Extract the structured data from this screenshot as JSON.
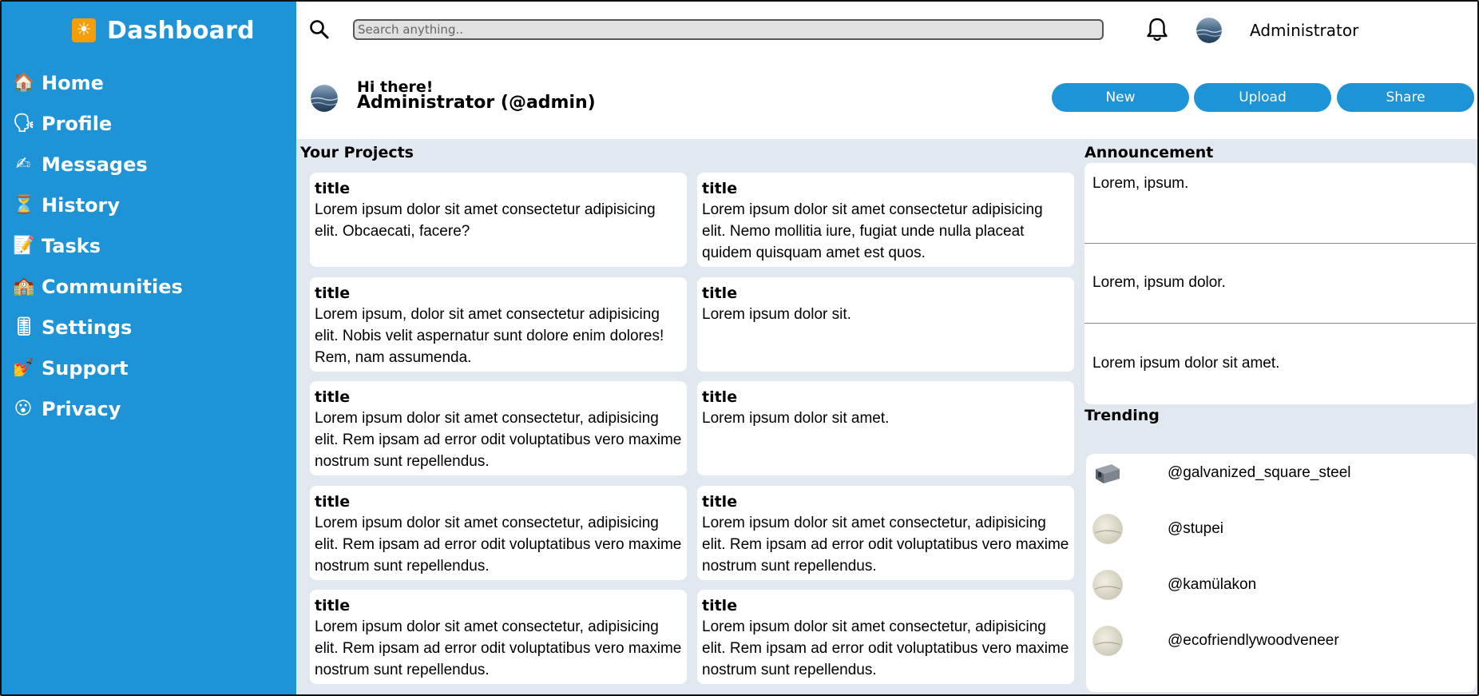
{
  "sidebar": {
    "brand_icon": "☀",
    "brand_title": "Dashboard",
    "items": [
      {
        "icon": "🏠",
        "icon_name": "home-icon",
        "label": "Home"
      },
      {
        "icon": "🗣",
        "icon_name": "speaking-head-icon",
        "label": "Profile"
      },
      {
        "icon": "✍",
        "icon_name": "writing-hand-icon",
        "label": "Messages"
      },
      {
        "icon": "⏳",
        "icon_name": "hourglass-icon",
        "label": "History"
      },
      {
        "icon": "📝",
        "icon_name": "memo-icon",
        "label": "Tasks"
      },
      {
        "icon": "🏫",
        "icon_name": "school-icon",
        "label": "Communities"
      },
      {
        "icon": "🎚",
        "icon_name": "slider-icon",
        "label": "Settings"
      },
      {
        "icon": "💅",
        "icon_name": "nail-polish-icon",
        "label": "Support"
      },
      {
        "icon": "😮",
        "icon_name": "face-icon",
        "label": "Privacy"
      }
    ]
  },
  "header": {
    "search_placeholder": "Search anything..",
    "user_name": "Administrator"
  },
  "greeting": {
    "hi": "Hi there!",
    "name": "Administrator (@admin)",
    "buttons": [
      "New",
      "Upload",
      "Share"
    ]
  },
  "projects": {
    "title": "Your Projects",
    "cards": [
      {
        "title": "title",
        "body": "Lorem ipsum dolor sit amet consectetur adipisicing elit. Obcaecati, facere?"
      },
      {
        "title": "title",
        "body": "Lorem ipsum dolor sit amet consectetur adipisicing elit. Nemo mollitia iure, fugiat unde nulla placeat quidem quisquam amet est quos."
      },
      {
        "title": "title",
        "body": "Lorem ipsum, dolor sit amet consectetur adipisicing elit. Nobis velit aspernatur sunt dolore enim dolores! Rem, nam assumenda."
      },
      {
        "title": "title",
        "body": "Lorem ipsum dolor sit."
      },
      {
        "title": "title",
        "body": "Lorem ipsum dolor sit amet consectetur, adipisicing elit. Rem ipsam ad error odit voluptatibus vero maxime nostrum sunt repellendus."
      },
      {
        "title": "title",
        "body": "Lorem ipsum dolor sit amet."
      },
      {
        "title": "title",
        "body": "Lorem ipsum dolor sit amet consectetur, adipisicing elit. Rem ipsam ad error odit voluptatibus vero maxime nostrum sunt repellendus."
      },
      {
        "title": "title",
        "body": "Lorem ipsum dolor sit amet consectetur, adipisicing elit. Rem ipsam ad error odit voluptatibus vero maxime nostrum sunt repellendus."
      },
      {
        "title": "title",
        "body": "Lorem ipsum dolor sit amet consectetur, adipisicing elit. Rem ipsam ad error odit voluptatibus vero maxime nostrum sunt repellendus."
      },
      {
        "title": "title",
        "body": "Lorem ipsum dolor sit amet consectetur, adipisicing elit. Rem ipsam ad error odit voluptatibus vero maxime nostrum sunt repellendus."
      }
    ]
  },
  "announcement": {
    "title": "Announcement",
    "items": [
      "Lorem, ipsum.",
      "Lorem, ipsum dolor.",
      "Lorem ipsum dolor sit amet."
    ]
  },
  "trending": {
    "title": "Trending",
    "users": [
      "@galvanized_square_steel",
      "@stupei",
      "@kamülakon",
      "@ecofriendlywoodveneer"
    ]
  },
  "colors": {
    "accent": "#1e93d6",
    "page_bg": "#e2e8f0"
  }
}
